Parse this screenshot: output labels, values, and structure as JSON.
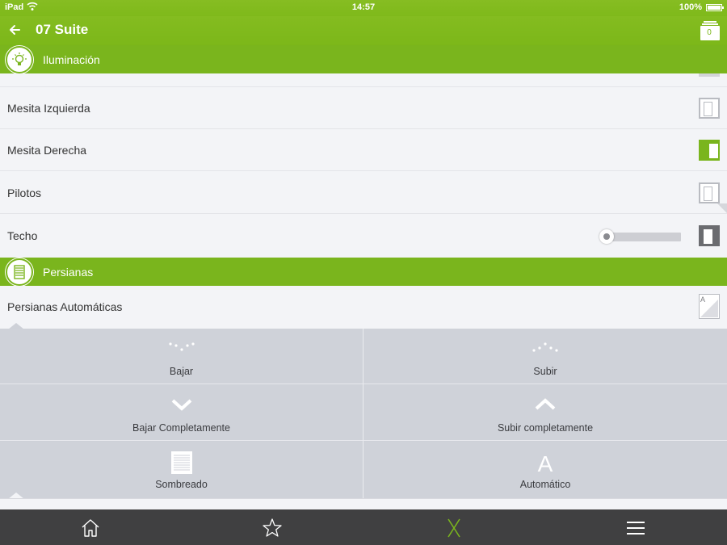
{
  "status_bar": {
    "device": "iPad",
    "time": "14:57",
    "battery": "100%"
  },
  "nav": {
    "title": "07 Suite",
    "cart_count": "0"
  },
  "sections": {
    "lighting": {
      "label": "Iluminación"
    },
    "blinds": {
      "label": "Persianas"
    }
  },
  "lighting_rows": [
    {
      "label": "Mesita Izquierda",
      "state": "off"
    },
    {
      "label": "Mesita Derecha",
      "state": "on"
    },
    {
      "label": "Pilotos",
      "state": "off"
    },
    {
      "label": "Techo",
      "state": "off",
      "dimmer_level": 0
    }
  ],
  "blinds_row": {
    "label": "Persianas Automáticas"
  },
  "blind_actions": [
    {
      "label": "Bajar",
      "icon": "dots-down-icon"
    },
    {
      "label": "Subir",
      "icon": "dots-up-icon"
    },
    {
      "label": "Bajar Completamente",
      "icon": "chevron-down-icon"
    },
    {
      "label": "Subir completamente",
      "icon": "chevron-up-icon"
    },
    {
      "label": "Sombreado",
      "icon": "blind-shade-icon"
    },
    {
      "label": "Automático",
      "icon": "letter-a-icon",
      "glyph": "A"
    }
  ],
  "colors": {
    "accent": "#7ab51d",
    "panel": "#cfd2d9",
    "tabbar": "#404041"
  },
  "tabbar": [
    {
      "icon": "home-icon"
    },
    {
      "icon": "star-icon"
    },
    {
      "icon": "x-logo-icon",
      "active": true
    },
    {
      "icon": "menu-icon"
    }
  ]
}
